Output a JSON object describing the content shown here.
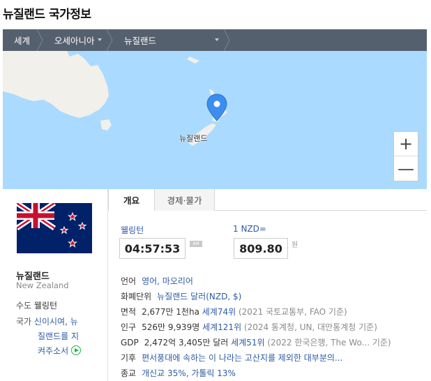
{
  "page": {
    "title": "뉴질랜드 국가정보"
  },
  "breadcrumb": {
    "items": [
      "세계",
      "오세아니아",
      "뉴질랜드"
    ]
  },
  "map": {
    "label": "뉴질랜드",
    "zoom_in": "+",
    "zoom_out": "—"
  },
  "country": {
    "name": "뉴질랜드",
    "name_en": "New Zealand",
    "capital_label": "수도",
    "capital": "웰링턴",
    "anthem_label": "국가",
    "anthem_line1": "신이시여, 뉴",
    "anthem_line2": "질랜드를 지",
    "anthem_line3": "켜주소서"
  },
  "tabs": [
    "개요",
    "경제·물가"
  ],
  "clock": {
    "city": "웰링턴",
    "time": "04:57:53",
    "ampm": "AM"
  },
  "fx": {
    "label": "1 NZD=",
    "value": "809.80",
    "unit": "원"
  },
  "info": {
    "language_label": "언어",
    "language": "영어, 마오리어",
    "currency_label": "화폐단위",
    "currency": "뉴질랜드 달러(NZD, $)",
    "area_label": "면적",
    "area": "2,677만 1천ha",
    "area_rank": "세계74위",
    "area_src": "(2021 국토교통부, FAO 기준)",
    "pop_label": "인구",
    "pop": "526만 9,939명",
    "pop_rank": "세계121위",
    "pop_src": "(2024 통계청, UN, 대만통계청 기준)",
    "gdp_label": "GDP",
    "gdp": "2,472억 3,405만 달러",
    "gdp_rank": "세계51위",
    "gdp_src": "(2022 한국은행, The Wo... 기준)",
    "climate_label": "기후",
    "climate": "편서풍대에 속하는 이 나라는 고산지를 제외한 대부분의...",
    "religion_label": "종교",
    "religion": "개신교 35%, 가톨릭 13%"
  },
  "colors": {
    "map_water": "#aadaff",
    "land": "#f2f0ea",
    "crumb_bar": "#55606e",
    "link": "#2e5aa8",
    "pin": "#3b8ef0"
  }
}
